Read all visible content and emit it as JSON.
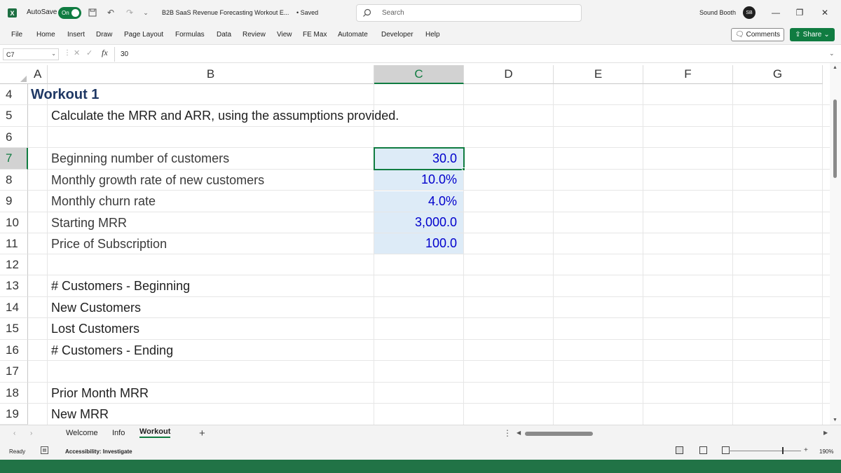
{
  "app": {
    "autosave_label": "AutoSave",
    "autosave_state": "On",
    "document_title": "B2B SaaS Revenue Forecasting Workout E...",
    "saved_status": "• Saved",
    "search_placeholder": "Search",
    "user_name": "Sound Booth",
    "user_initials": "SB",
    "accent_color": "#107c41"
  },
  "menu": {
    "items": [
      "File",
      "Home",
      "Insert",
      "Draw",
      "Page Layout",
      "Formulas",
      "Data",
      "Review",
      "View",
      "FE Max",
      "Automate",
      "Developer",
      "Help"
    ],
    "comments_label": "Comments",
    "share_label": "Share"
  },
  "formula_bar": {
    "name_box": "C7",
    "fx_label": "fx",
    "formula": "30"
  },
  "sheet": {
    "columns": [
      "A",
      "B",
      "C",
      "D",
      "E",
      "F",
      "G"
    ],
    "selected_column": "C",
    "rows": [
      "4",
      "5",
      "6",
      "7",
      "8",
      "9",
      "10",
      "11",
      "12",
      "13",
      "14",
      "15",
      "16",
      "17",
      "18",
      "19"
    ],
    "selected_row": "7",
    "title": "Workout 1",
    "instruction": "Calculate the MRR and ARR, using the assumptions provided.",
    "assumptions": [
      {
        "label": "Beginning number of customers",
        "value": "30.0"
      },
      {
        "label": "Monthly growth rate of new customers",
        "value": "10.0%"
      },
      {
        "label": "Monthly churn rate",
        "value": "4.0%"
      },
      {
        "label": "Starting MRR",
        "value": "3,000.0"
      },
      {
        "label": "Price of Subscription",
        "value": "100.0"
      }
    ],
    "calc_labels": [
      "# Customers - Beginning",
      "New Customers",
      "Lost Customers",
      "# Customers - Ending",
      "Prior Month MRR",
      "New MRR"
    ]
  },
  "tabs": {
    "items": [
      "Welcome",
      "Info",
      "Workout"
    ],
    "active": "Workout",
    "add_label": "+"
  },
  "status": {
    "ready": "Ready",
    "accessibility": "Accessibility: Investigate",
    "zoom": "190%"
  }
}
